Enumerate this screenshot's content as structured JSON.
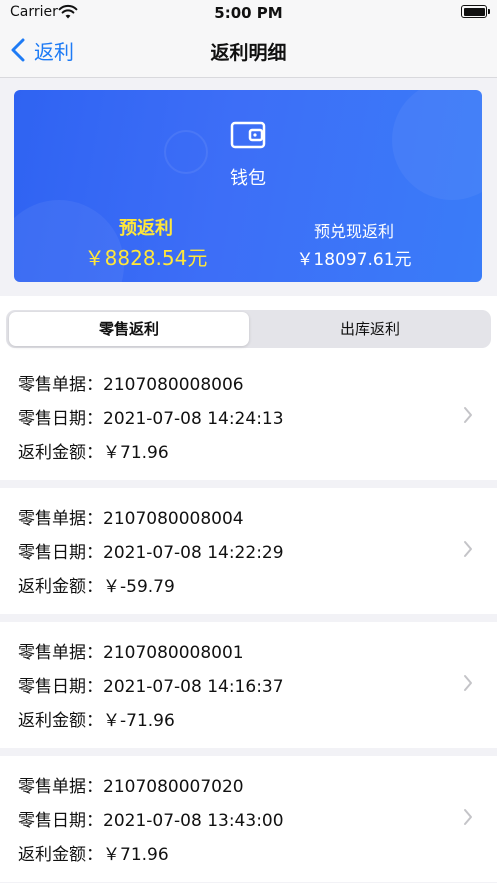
{
  "status_bar": {
    "carrier": "Carrier",
    "time": "5:00 PM"
  },
  "nav": {
    "back_label": "返利",
    "title": "返利明细"
  },
  "wallet": {
    "label": "钱包",
    "pre_rebate_label": "预返利",
    "pre_rebate_value": "￥8828.54元",
    "pre_redeem_label": "预兑现返利",
    "pre_redeem_value": "￥18097.61元"
  },
  "tabs": [
    {
      "label": "零售返利",
      "selected": true
    },
    {
      "label": "出库返利",
      "selected": false
    }
  ],
  "field_labels": {
    "order": "零售单据：",
    "date": "零售日期：",
    "amount": "返利金额："
  },
  "records": [
    {
      "order": "2107080008006",
      "date": "2021-07-08 14:24:13",
      "amount": "￥71.96"
    },
    {
      "order": "2107080008004",
      "date": "2021-07-08 14:22:29",
      "amount": "￥-59.79"
    },
    {
      "order": "2107080008001",
      "date": "2021-07-08 14:16:37",
      "amount": "￥-71.96"
    },
    {
      "order": "2107080007020",
      "date": "2021-07-08 13:43:00",
      "amount": "￥71.96"
    }
  ],
  "colors": {
    "accent": "#1e7bf5",
    "card": "#3a6cf6",
    "highlight": "#ffe73a"
  }
}
